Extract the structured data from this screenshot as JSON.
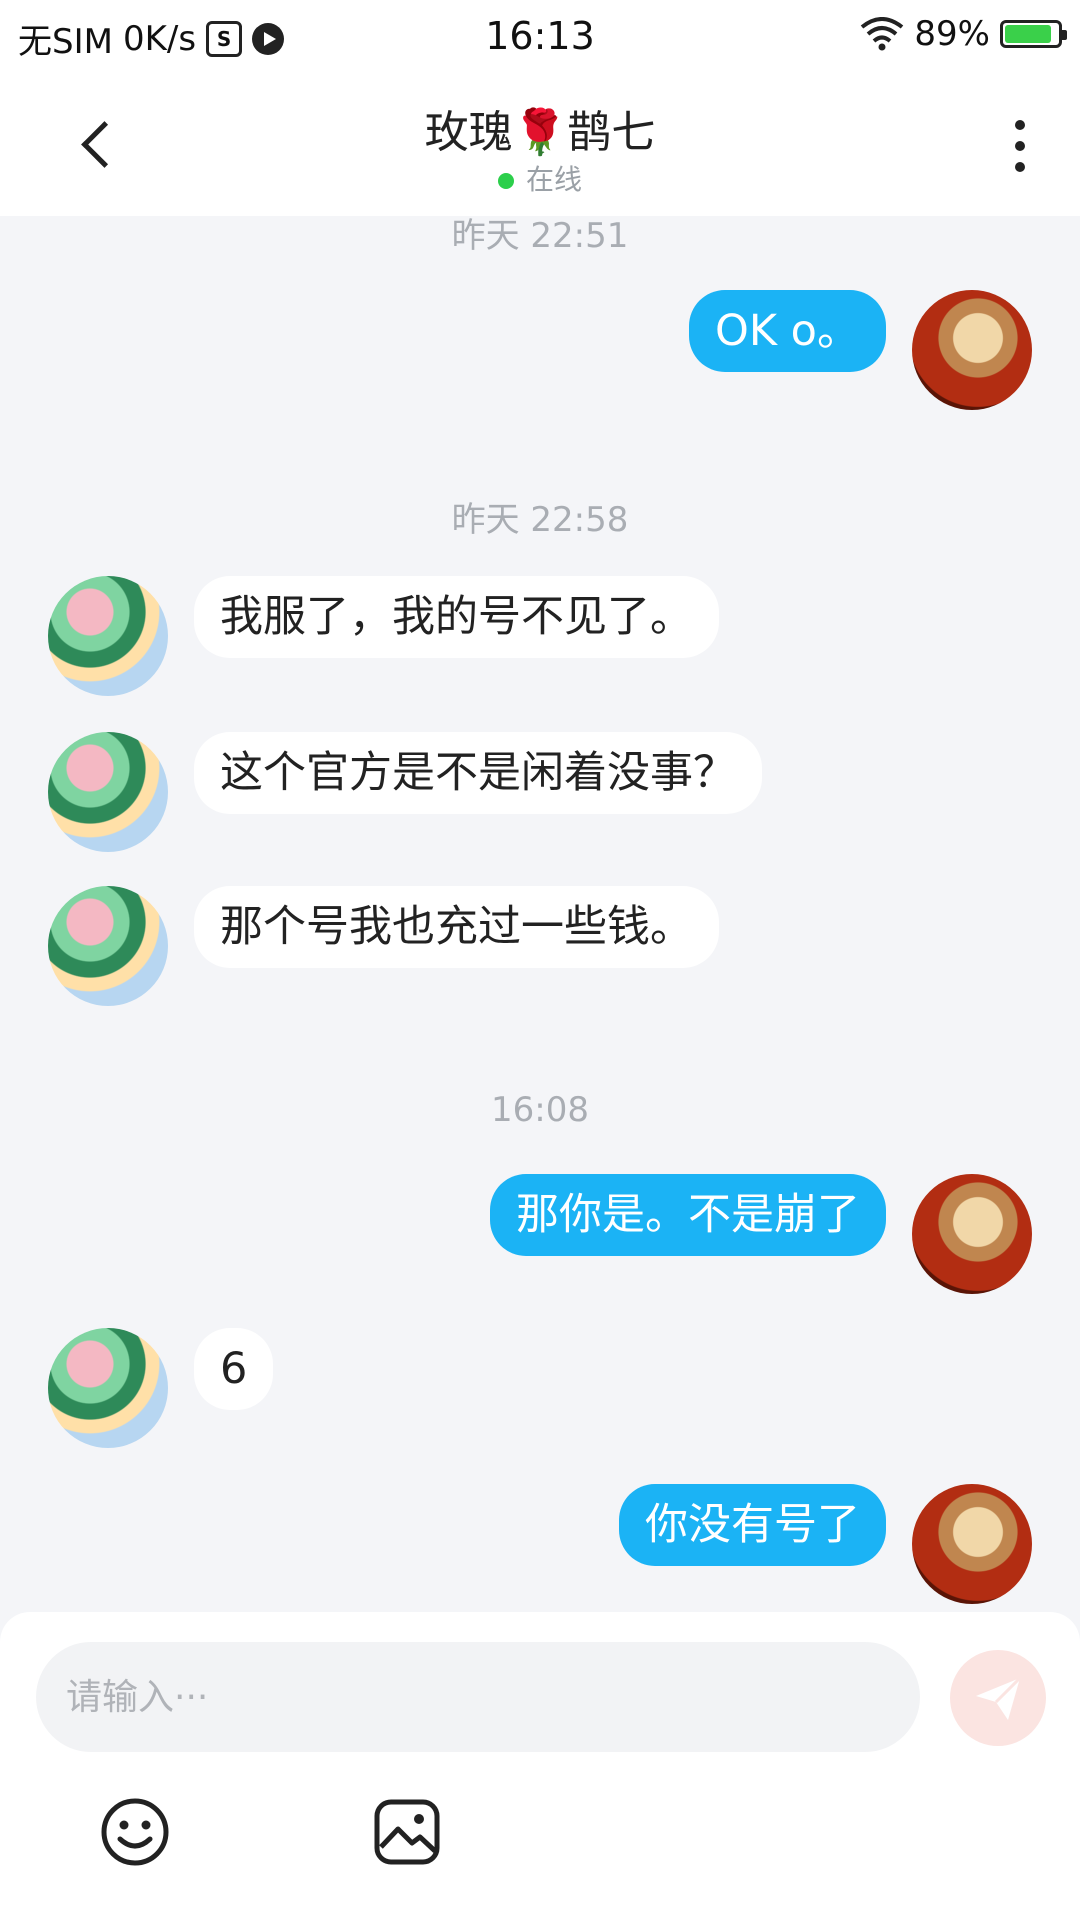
{
  "status_bar": {
    "carrier": "无SIM",
    "speed": "0K/s",
    "time": "16:13",
    "battery": "89%",
    "battery_level": 0.89
  },
  "header": {
    "title_left": "玫瑰",
    "title_emoji": "🌹",
    "title_right": "鹊七",
    "status": "在线"
  },
  "messages": [
    {
      "type": "timestamp",
      "text": "昨天 22:51"
    },
    {
      "type": "me",
      "text": "OK o。"
    },
    {
      "type": "timestamp",
      "text": "昨天 22:58"
    },
    {
      "type": "them",
      "text": "我服了，我的号不见了。"
    },
    {
      "type": "them",
      "text": "这个官方是不是闲着没事？"
    },
    {
      "type": "them",
      "text": "那个号我也充过一些钱。"
    },
    {
      "type": "timestamp",
      "text": "16:08"
    },
    {
      "type": "me",
      "text": "那你是。不是崩了"
    },
    {
      "type": "them",
      "text": "6"
    },
    {
      "type": "me",
      "text": "你没有号了"
    }
  ],
  "input": {
    "placeholder": "请输入···"
  },
  "icons": {
    "back": "back-arrow-icon",
    "more": "more-vertical-icon",
    "send": "send-icon",
    "emoji": "emoji-icon",
    "image": "image-icon"
  },
  "colors": {
    "my_bubble": "#1bb3f5",
    "their_bubble": "#ffffff",
    "online_dot": "#2ccf4b",
    "send_button": "#fbe4e1"
  }
}
